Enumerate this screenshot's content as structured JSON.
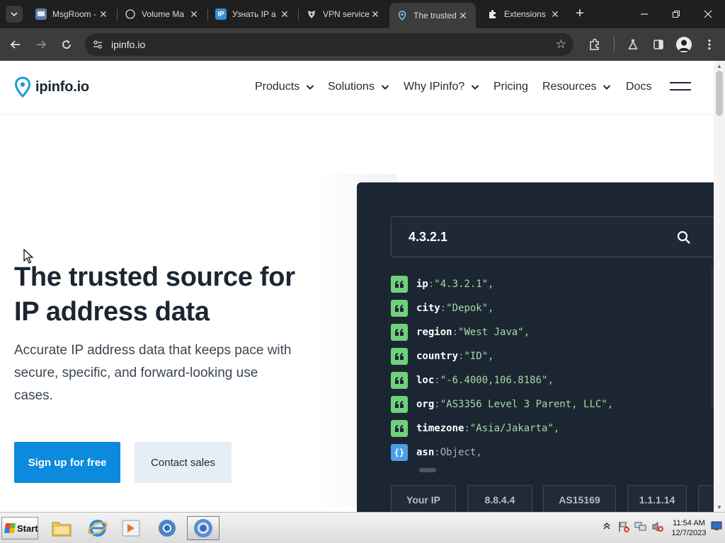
{
  "browser": {
    "tabs": [
      {
        "title": "MsgRoom -",
        "favicon": "msgroom-icon"
      },
      {
        "title": "Volume Ma",
        "favicon": "globe-icon"
      },
      {
        "title": "Узнать IP а",
        "favicon": "ip-icon"
      },
      {
        "title": "VPN service",
        "favicon": "vpn-icon"
      },
      {
        "title": "The trusted",
        "favicon": "ipinfo-icon"
      },
      {
        "title": "Extensions",
        "favicon": "puzzle-icon"
      }
    ],
    "active_tab_index": 4,
    "url": "ipinfo.io"
  },
  "site": {
    "logo_text": "ipinfo.io",
    "nav": [
      {
        "label": "Products",
        "has_dropdown": true
      },
      {
        "label": "Solutions",
        "has_dropdown": true
      },
      {
        "label": "Why IPinfo?",
        "has_dropdown": true
      },
      {
        "label": "Pricing",
        "has_dropdown": false
      },
      {
        "label": "Resources",
        "has_dropdown": true
      },
      {
        "label": "Docs",
        "has_dropdown": false
      }
    ],
    "hero": {
      "title": "The trusted source for IP address data",
      "subtitle": "Accurate IP address data that keeps pace with secure, specific, and forward-looking use cases.",
      "primary_cta": "Sign up for free",
      "secondary_cta": "Contact sales"
    },
    "lookup": {
      "ip_value": "4.3.2.1",
      "rows": [
        {
          "key": "ip",
          "value": "\"4.3.2.1\",",
          "type": "string"
        },
        {
          "key": "city",
          "value": "\"Depok\",",
          "type": "string"
        },
        {
          "key": "region",
          "value": "\"West Java\",",
          "type": "string"
        },
        {
          "key": "country",
          "value": "\"ID\",",
          "type": "string"
        },
        {
          "key": "loc",
          "value": "\"-6.4000,106.8186\",",
          "type": "string"
        },
        {
          "key": "org",
          "value": "\"AS3356 Level 3 Parent, LLC\",",
          "type": "string"
        },
        {
          "key": "timezone",
          "value": "\"Asia/Jakarta\",",
          "type": "string"
        },
        {
          "key": "asn",
          "value": "Object,",
          "type": "object"
        }
      ],
      "object_badge": "{}",
      "quick_chips": [
        "Your IP",
        "8.8.4.4",
        "AS15169",
        "1.1.1.14"
      ]
    },
    "colors": {
      "primary": "#0b8ade",
      "panel_bg": "#1c2633",
      "string_badge": "#6fd17c",
      "object_badge": "#4d9ee8",
      "code_value": "#a8d9a0"
    }
  },
  "taskbar": {
    "start_label": "Start",
    "clock_time": "11:54 AM",
    "clock_date": "12/7/2023"
  }
}
